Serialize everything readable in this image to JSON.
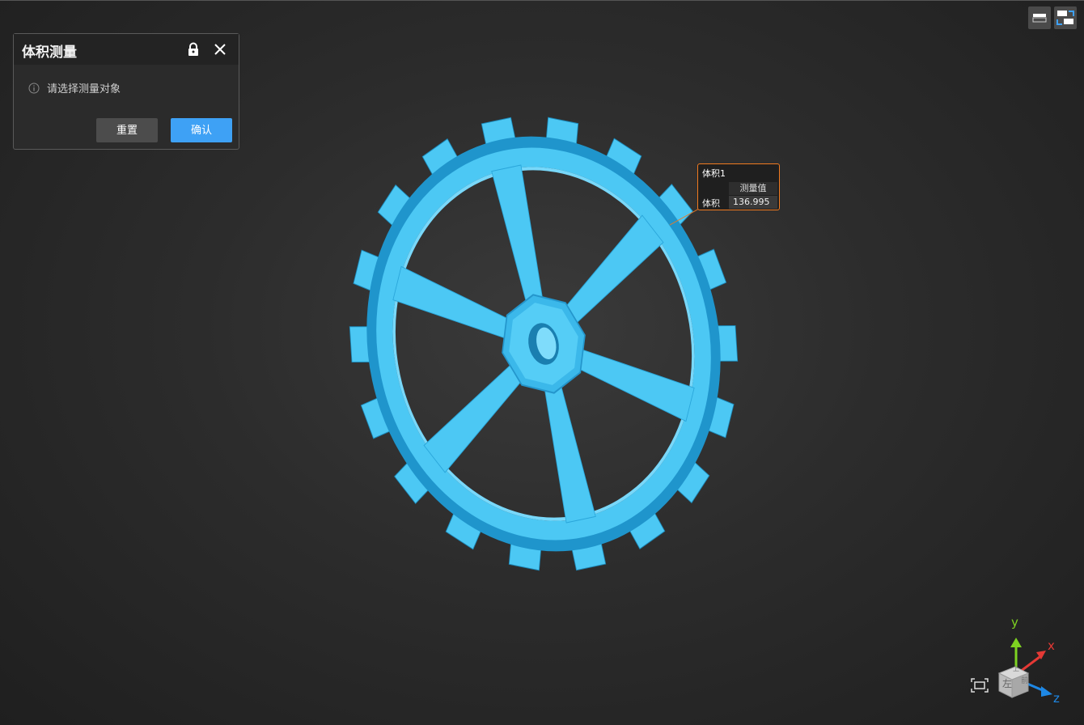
{
  "dialog": {
    "title": "体积测量",
    "hint": "请选择测量对象",
    "reset_label": "重置",
    "confirm_label": "确认"
  },
  "callout": {
    "title": "体积1",
    "column_header": "测量值",
    "row_label": "体积",
    "row_value": "136.995"
  },
  "axes": {
    "y": "y",
    "x": "x",
    "z": "z"
  },
  "view_cube": {
    "face_front": "左",
    "face_side": "前",
    "face_top": "上"
  },
  "colors": {
    "model": "#4cc8f4",
    "accent": "#3ea1f5",
    "callout_border": "#f07a20",
    "axis_x": "#e53935",
    "axis_y": "#7ed321",
    "axis_z": "#1e88e5"
  },
  "icons": [
    "lock-icon",
    "close-icon",
    "info-icon",
    "view-toggle-icon",
    "split-view-icon",
    "fit-view-icon"
  ]
}
